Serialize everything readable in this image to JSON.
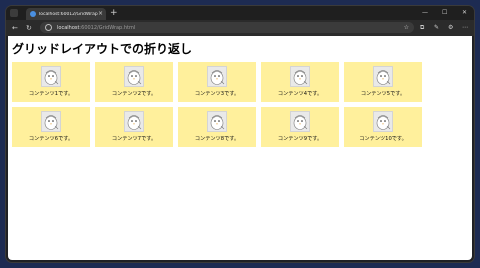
{
  "browser": {
    "tab_title": "localhost:60012/GridWrap.html",
    "tab_close": "×",
    "new_tab": "+",
    "url_host": "localhost",
    "url_path": ":60012/GridWrap.html",
    "window_controls": {
      "minimize": "—",
      "maximize": "☐",
      "close": "✕"
    },
    "nav": {
      "back": "←",
      "reload": "↻"
    },
    "toolbar_icons": [
      "☆",
      "⧉",
      "✎",
      "⚙",
      "⋯"
    ]
  },
  "page": {
    "title": "グリッドレイアウトでの折り返し",
    "cards": [
      {
        "label": "コンテンツ1です。"
      },
      {
        "label": "コンテンツ2です。"
      },
      {
        "label": "コンテンツ3です。"
      },
      {
        "label": "コンテンツ4です。"
      },
      {
        "label": "コンテンツ5です。"
      },
      {
        "label": "コンテンツ6です。"
      },
      {
        "label": "コンテンツ7です。"
      },
      {
        "label": "コンテンツ8です。"
      },
      {
        "label": "コンテンツ9です。"
      },
      {
        "label": "コンテンツ10です。"
      }
    ]
  },
  "colors": {
    "card_background": "#fff09c",
    "page_background": "#ffffff",
    "desktop_background": "#1d2b52"
  }
}
